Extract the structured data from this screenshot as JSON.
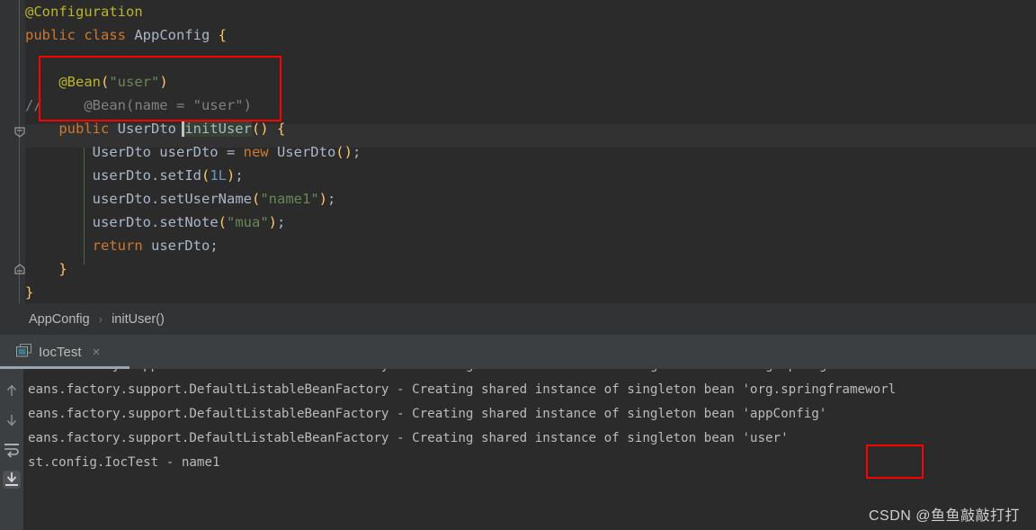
{
  "colors": {
    "editor_bg": "#2b2b2b",
    "gutter_bg": "#313335",
    "panel_bg": "#3c3f41",
    "annotation": "#bbb529",
    "keyword": "#cc7832",
    "string": "#6a8759",
    "method": "#ffc66d",
    "number": "#6897bb",
    "text": "#a9b7c6",
    "comment": "#808080",
    "highlight_box": "#ff0000",
    "tab_underline": "#9aa7b0"
  },
  "editor": {
    "lines": [
      {
        "id": "line-annotation-configuration",
        "tokens": [
          {
            "cls": "t-ann",
            "text": "@Configuration"
          }
        ]
      },
      {
        "id": "line-class-decl",
        "tokens": [
          {
            "cls": "t-kw",
            "text": "public "
          },
          {
            "cls": "t-kw",
            "text": "class "
          },
          {
            "cls": "t-cls",
            "text": "AppConfig "
          },
          {
            "cls": "t-yellow",
            "text": "{"
          }
        ]
      },
      {
        "id": "line-blank-1",
        "tokens": [
          {
            "cls": "t-punc",
            "text": ""
          }
        ]
      },
      {
        "id": "line-annotation-bean",
        "tokens": [
          {
            "cls": "t-punc",
            "text": "    "
          },
          {
            "cls": "t-ann",
            "text": "@Bean"
          },
          {
            "cls": "t-yellow",
            "text": "("
          },
          {
            "cls": "t-str",
            "text": "\"user\""
          },
          {
            "cls": "t-yellow",
            "text": ")"
          }
        ]
      },
      {
        "id": "line-commented-bean",
        "tokens": [
          {
            "cls": "t-comment",
            "text": "//     @Bean(name = \"user\")"
          }
        ]
      },
      {
        "id": "line-method-signature",
        "tokens": [
          {
            "cls": "t-punc",
            "text": "    "
          },
          {
            "cls": "t-kw",
            "text": "public "
          },
          {
            "cls": "t-cls",
            "text": "UserDto "
          },
          {
            "cls": "sel-ident",
            "text": "initUser"
          },
          {
            "cls": "t-yellow",
            "text": "()"
          },
          {
            "cls": "t-punc",
            "text": " "
          },
          {
            "cls": "t-yellow",
            "text": "{"
          }
        ]
      },
      {
        "id": "line-new-userdto",
        "tokens": [
          {
            "cls": "t-punc",
            "text": "        "
          },
          {
            "cls": "t-cls",
            "text": "UserDto userDto "
          },
          {
            "cls": "t-punc",
            "text": "= "
          },
          {
            "cls": "t-kw",
            "text": "new "
          },
          {
            "cls": "t-cls",
            "text": "UserDto"
          },
          {
            "cls": "t-yellow",
            "text": "()"
          },
          {
            "cls": "t-punc",
            "text": ";"
          }
        ]
      },
      {
        "id": "line-set-id",
        "tokens": [
          {
            "cls": "t-punc",
            "text": "        "
          },
          {
            "cls": "t-cls",
            "text": "userDto"
          },
          {
            "cls": "t-punc",
            "text": "."
          },
          {
            "cls": "t-cls",
            "text": "setId"
          },
          {
            "cls": "t-yellow",
            "text": "("
          },
          {
            "cls": "t-num",
            "text": "1L"
          },
          {
            "cls": "t-yellow",
            "text": ")"
          },
          {
            "cls": "t-punc",
            "text": ";"
          }
        ]
      },
      {
        "id": "line-set-username",
        "tokens": [
          {
            "cls": "t-punc",
            "text": "        "
          },
          {
            "cls": "t-cls",
            "text": "userDto"
          },
          {
            "cls": "t-punc",
            "text": "."
          },
          {
            "cls": "t-cls",
            "text": "setUserName"
          },
          {
            "cls": "t-yellow",
            "text": "("
          },
          {
            "cls": "t-str",
            "text": "\"name1\""
          },
          {
            "cls": "t-yellow",
            "text": ")"
          },
          {
            "cls": "t-punc",
            "text": ";"
          }
        ]
      },
      {
        "id": "line-set-note",
        "tokens": [
          {
            "cls": "t-punc",
            "text": "        "
          },
          {
            "cls": "t-cls",
            "text": "userDto"
          },
          {
            "cls": "t-punc",
            "text": "."
          },
          {
            "cls": "t-cls",
            "text": "setNote"
          },
          {
            "cls": "t-yellow",
            "text": "("
          },
          {
            "cls": "t-str",
            "text": "\"mua\""
          },
          {
            "cls": "t-yellow",
            "text": ")"
          },
          {
            "cls": "t-punc",
            "text": ";"
          }
        ]
      },
      {
        "id": "line-return",
        "tokens": [
          {
            "cls": "t-punc",
            "text": "        "
          },
          {
            "cls": "t-kw",
            "text": "return "
          },
          {
            "cls": "t-cls",
            "text": "userDto"
          },
          {
            "cls": "t-punc",
            "text": ";"
          }
        ]
      },
      {
        "id": "line-close-method",
        "tokens": [
          {
            "cls": "t-punc",
            "text": "    "
          },
          {
            "cls": "t-yellow",
            "text": "}"
          }
        ]
      },
      {
        "id": "line-close-class",
        "tokens": [
          {
            "cls": "t-yellow",
            "text": "}"
          }
        ]
      }
    ],
    "selected_identifier": "initUser",
    "highlight_note": "red rectangle drawn around the @Bean(\"user\") annotation block"
  },
  "breadcrumb": {
    "items": [
      "AppConfig",
      "initUser()"
    ],
    "separator": "›"
  },
  "run_window": {
    "tab_label": "IocTest",
    "tab_icon": "run-configuration-icon",
    "close_label": "×",
    "gutter_buttons": [
      {
        "name": "up-arrow-icon",
        "title": "Previous Occurrence"
      },
      {
        "name": "down-arrow-icon",
        "title": "Next Occurrence"
      },
      {
        "name": "soft-wrap-icon",
        "title": "Soft-Wrap"
      },
      {
        "name": "scroll-to-end-icon",
        "title": "Scroll to End"
      }
    ],
    "console_lines": [
      "eans.factory.support.DefaultListableBeanFactory - Creating shared instance of singleton bean 'org.springframeworl",
      "eans.factory.support.DefaultListableBeanFactory - Creating shared instance of singleton bean 'org.springframeworl",
      "eans.factory.support.DefaultListableBeanFactory - Creating shared instance of singleton bean 'appConfig'",
      "eans.factory.support.DefaultListableBeanFactory - Creating shared instance of singleton bean 'user'",
      "st.config.IocTest - name1"
    ],
    "highlighted_console_token": "'user'"
  },
  "watermark": {
    "text": "CSDN @鱼鱼敲敲打打"
  }
}
